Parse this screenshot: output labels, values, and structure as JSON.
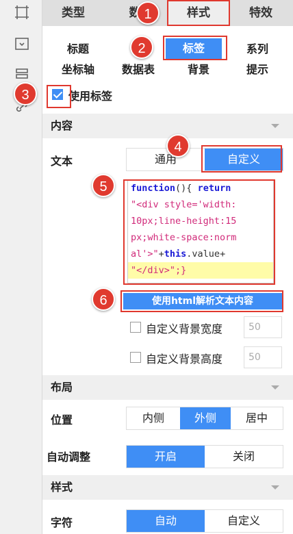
{
  "top_tabs": {
    "type": "类型",
    "data": "数",
    "style": "样式",
    "effect": "特效"
  },
  "sub_tabs": {
    "title": "标题",
    "legend": "图",
    "label": "标签",
    "series": "系列",
    "axis": "坐标轴",
    "table": "数据表",
    "background": "背景",
    "tooltip": "提示"
  },
  "use_label": {
    "text": "使用标签",
    "checked": true
  },
  "content_section": {
    "title": "内容"
  },
  "text_row": {
    "label": "文本",
    "option_general": "通用",
    "option_custom": "自定义",
    "selected": "自定义"
  },
  "code": {
    "lines": [
      {
        "k1": "function",
        "p1": "(){",
        "k2": "return"
      },
      {
        "s": "\"<div style='width:"
      },
      {
        "s": "10px;line-height:15"
      },
      {
        "s": "px;white-space:norm"
      },
      {
        "s": "al'>\"",
        "p": "+",
        "k": "this",
        "p2": ".value+"
      },
      {
        "s": "\"</div>\"",
        "p": ";}"
      }
    ]
  },
  "html_button": {
    "label": "使用html解析文本内容"
  },
  "bg_width": {
    "label": "自定义背景宽度",
    "value": "50"
  },
  "bg_height": {
    "label": "自定义背景高度",
    "value": "50"
  },
  "layout_section": {
    "title": "布局"
  },
  "position_row": {
    "label": "位置",
    "inside": "内侧",
    "outside": "外侧",
    "center": "居中",
    "selected": "外侧"
  },
  "auto_adjust_row": {
    "label": "自动调整",
    "on": "开启",
    "off": "关闭",
    "selected": "开启"
  },
  "style_section": {
    "title": "样式"
  },
  "char_row": {
    "label": "字符",
    "auto": "自动",
    "custom": "自定义",
    "selected": "自动"
  },
  "badges": [
    "1",
    "2",
    "3",
    "4",
    "5",
    "6"
  ],
  "colors": {
    "accent": "#3f8ef5",
    "annotation": "#e0382e",
    "highlight": "#fffca8"
  }
}
